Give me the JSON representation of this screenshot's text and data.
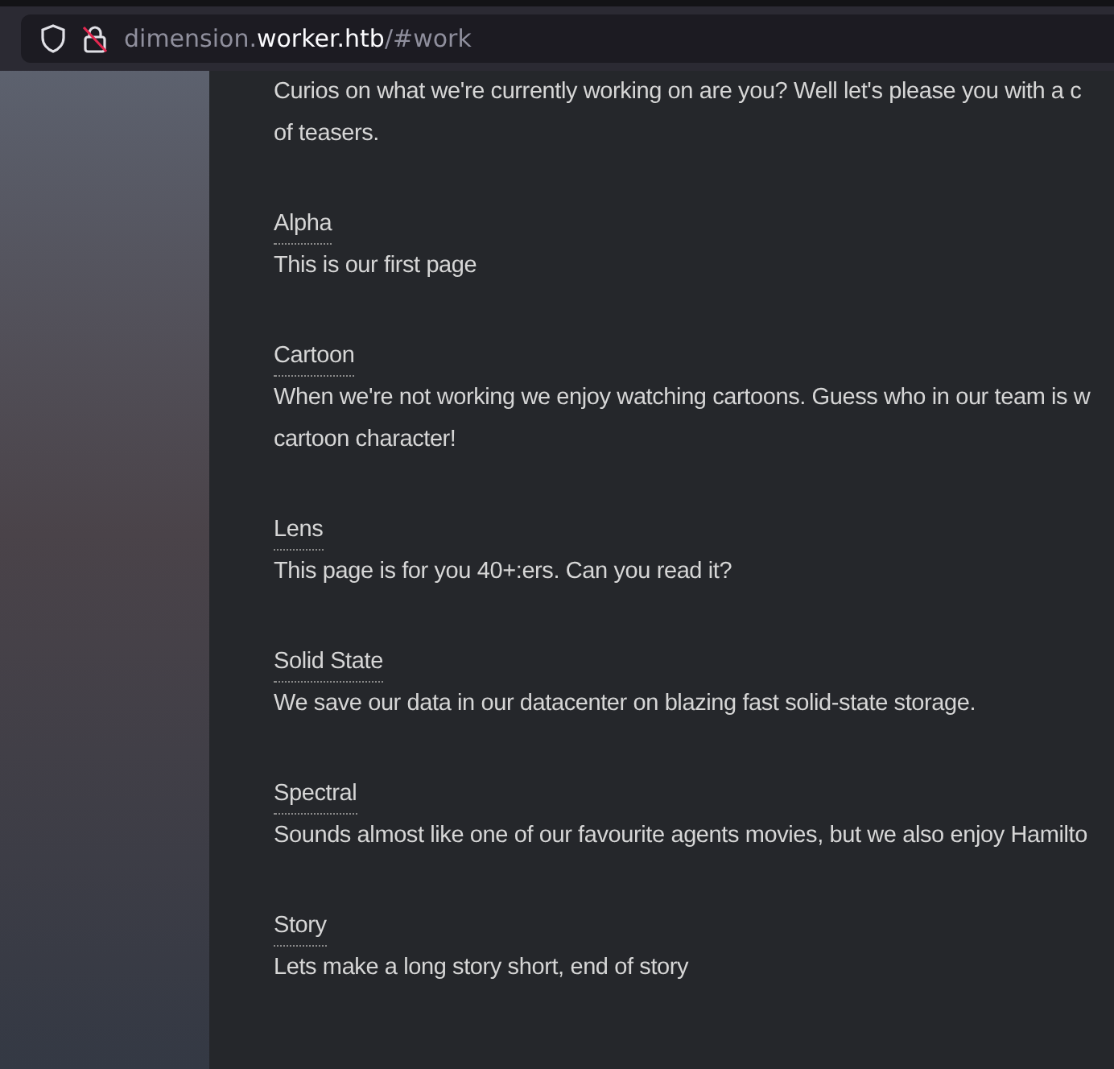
{
  "address_bar": {
    "subdomain": "dimension.",
    "domain": "worker.htb",
    "path": "/#work"
  },
  "intro_lines": [
    "Curios on what we're currently working on are you? Well let's please you with a c",
    "of teasers."
  ],
  "projects": [
    {
      "title": "Alpha",
      "lines": [
        "This is our first page"
      ]
    },
    {
      "title": "Cartoon",
      "lines": [
        "When we're not working we enjoy watching cartoons. Guess who in our team is w",
        "cartoon character!"
      ]
    },
    {
      "title": "Lens",
      "lines": [
        "This page is for you 40+:ers. Can you read it?"
      ]
    },
    {
      "title": "Solid State",
      "lines": [
        "We save our data in our datacenter on blazing fast solid-state storage."
      ]
    },
    {
      "title": "Spectral",
      "lines": [
        "Sounds almost like one of our favourite agents movies, but we also enjoy Hamilto"
      ]
    },
    {
      "title": "Story",
      "lines": [
        "Lets make a long story short, end of story"
      ]
    }
  ]
}
